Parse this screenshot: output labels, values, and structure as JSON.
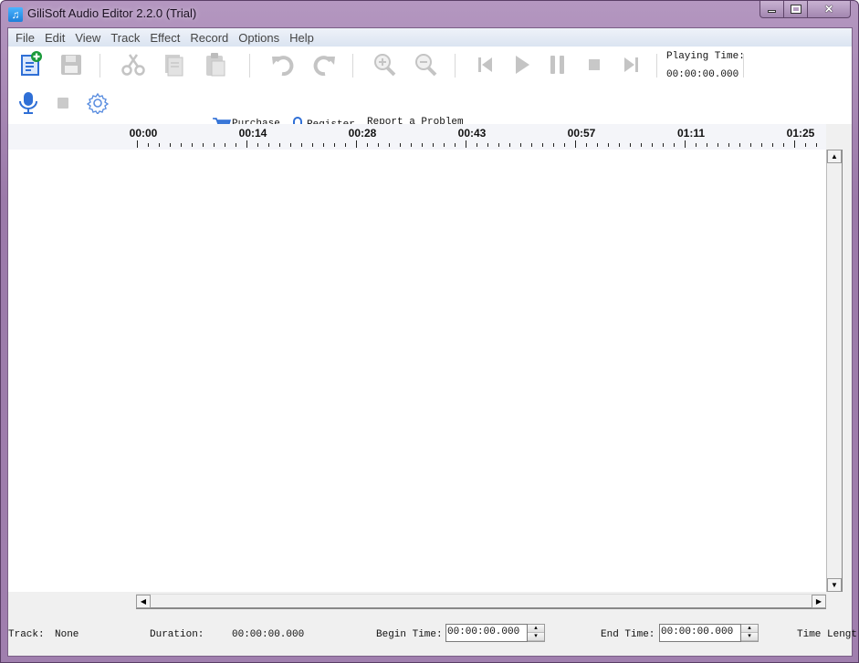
{
  "window": {
    "title": "GiliSoft Audio Editor 2.2.0 (Trial)",
    "app_icon": "music-note-icon",
    "controls": {
      "minimize": "minimize-icon",
      "maximize": "maximize-icon",
      "close": "close-icon"
    }
  },
  "menu": [
    "File",
    "Edit",
    "View",
    "Track",
    "Effect",
    "Record",
    "Options",
    "Help"
  ],
  "toolbar": {
    "buttons": [
      {
        "name": "new-file",
        "icon": "new-document-icon",
        "enabled": true
      },
      {
        "name": "save",
        "icon": "floppy-disk-icon",
        "enabled": false
      },
      {
        "name": "cut",
        "icon": "scissors-icon",
        "enabled": false
      },
      {
        "name": "copy",
        "icon": "copy-icon",
        "enabled": false
      },
      {
        "name": "paste",
        "icon": "clipboard-icon",
        "enabled": false
      },
      {
        "name": "undo",
        "icon": "undo-icon",
        "enabled": false
      },
      {
        "name": "redo",
        "icon": "redo-icon",
        "enabled": false
      },
      {
        "name": "zoom-in",
        "icon": "zoom-in-icon",
        "enabled": false
      },
      {
        "name": "zoom-out",
        "icon": "zoom-out-icon",
        "enabled": false
      },
      {
        "name": "skip-back",
        "icon": "skip-back-icon",
        "enabled": false
      },
      {
        "name": "play",
        "icon": "play-icon",
        "enabled": false
      },
      {
        "name": "pause",
        "icon": "pause-icon",
        "enabled": false
      },
      {
        "name": "stop",
        "icon": "stop-icon",
        "enabled": false
      },
      {
        "name": "skip-forward",
        "icon": "skip-forward-icon",
        "enabled": false
      },
      {
        "name": "record",
        "icon": "microphone-icon",
        "enabled": true
      },
      {
        "name": "record-stop",
        "icon": "stop-icon",
        "enabled": false
      },
      {
        "name": "settings",
        "icon": "gear-icon",
        "enabled": true
      }
    ],
    "playing_time_label": "Playing Time:",
    "playing_time_value": "00:00:00.000"
  },
  "links": {
    "purchase": "Purchase",
    "register": "Register",
    "report": "Report a Problem"
  },
  "ruler": {
    "labels": [
      "00:00",
      "00:14",
      "00:28",
      "00:43",
      "00:57",
      "01:11",
      "01:25"
    ],
    "minor_ticks_per_major": 10
  },
  "status": {
    "track_label": "Track:",
    "track_value": "None",
    "duration_label": "Duration:",
    "duration_value": "00:00:00.000",
    "begin_label": "Begin Time:",
    "begin_value": "00:00:00.000",
    "end_label": "End Time:",
    "end_value": "00:00:00.000",
    "length_label": "Time Lengt"
  },
  "colors": {
    "frame": "#a07fae",
    "icon_blue": "#2f6fd6",
    "icon_disabled": "#c4c4c4",
    "ruler_bg": "#f4f5f9"
  }
}
